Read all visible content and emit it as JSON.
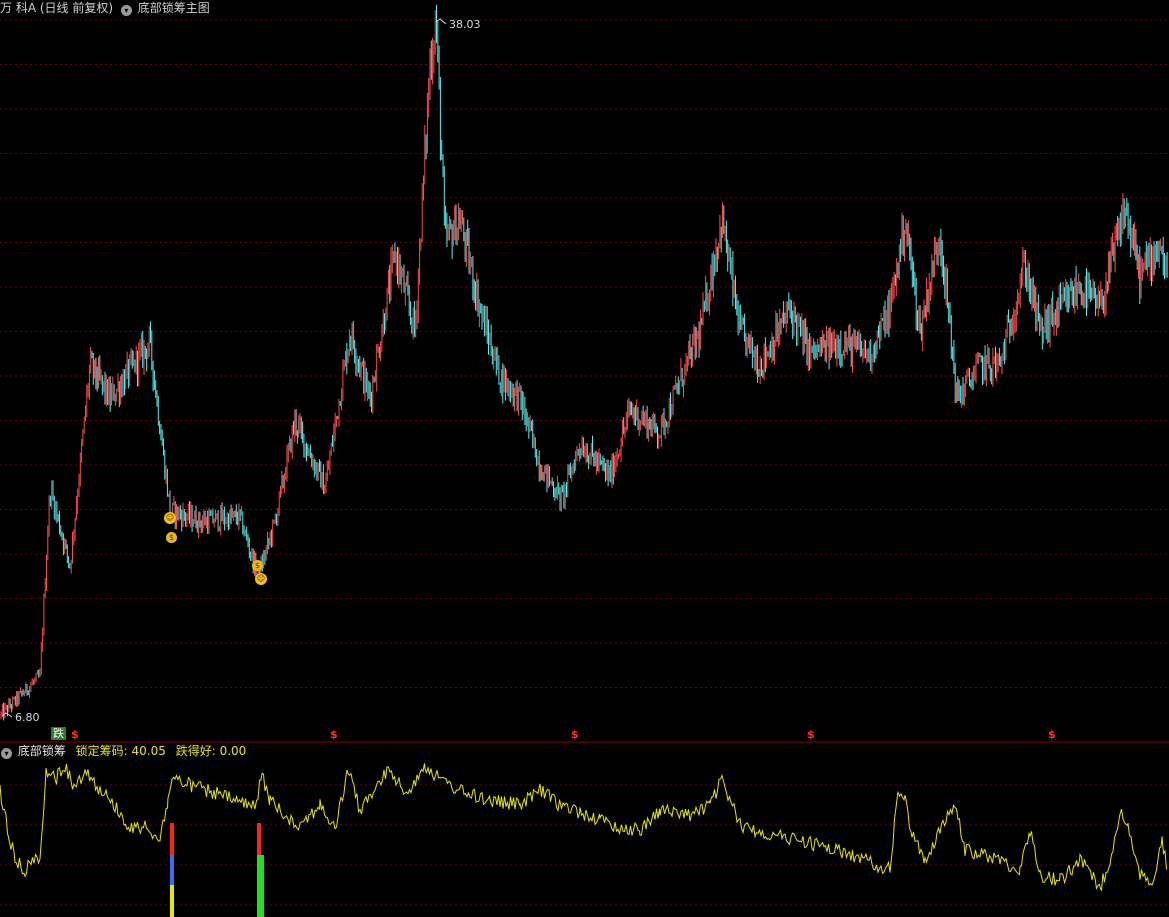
{
  "header": {
    "stock_name": "万 科A",
    "mode": "(日线 前复权)",
    "main_indicator": "底部锁筹主图"
  },
  "sub_header": {
    "indicator": "底部锁筹",
    "lock_label": "锁定筹码: 40.05",
    "good_label": "跌得好: 0.00"
  },
  "labels": {
    "high": "38.03",
    "low": "6.80",
    "die": "跌",
    "dollar": "$"
  },
  "colors": {
    "up": "#ff4c4c",
    "down": "#4cf0f0",
    "indicator_line": "#e6e600",
    "grid": "#6a0000",
    "separator": "#8b0000",
    "bar_red": "#ff2020",
    "bar_green": "#20e020"
  },
  "chart_data": [
    {
      "type": "candlestick",
      "title": "万 科A (日线 前复权)",
      "ylim": [
        6.8,
        38.03
      ],
      "labels": {
        "max": 38.03,
        "min": 6.8
      },
      "close_trend": [
        [
          0,
          6.8
        ],
        [
          40,
          8.6
        ],
        [
          50,
          17.0
        ],
        [
          70,
          13.5
        ],
        [
          90,
          22.5
        ],
        [
          110,
          21.0
        ],
        [
          150,
          23.5
        ],
        [
          170,
          16.0
        ],
        [
          200,
          15.5
        ],
        [
          240,
          15.7
        ],
        [
          258,
          13.0
        ],
        [
          275,
          15.5
        ],
        [
          295,
          20.0
        ],
        [
          325,
          17.0
        ],
        [
          350,
          24.0
        ],
        [
          370,
          21.0
        ],
        [
          395,
          27.5
        ],
        [
          415,
          24.0
        ],
        [
          430,
          36.0
        ],
        [
          436,
          38.0
        ],
        [
          445,
          28.0
        ],
        [
          460,
          29.0
        ],
        [
          480,
          25.0
        ],
        [
          500,
          22.0
        ],
        [
          520,
          21.0
        ],
        [
          540,
          18.0
        ],
        [
          562,
          16.5
        ],
        [
          580,
          19.0
        ],
        [
          610,
          17.5
        ],
        [
          630,
          20.5
        ],
        [
          660,
          19.5
        ],
        [
          700,
          24.0
        ],
        [
          722,
          29.0
        ],
        [
          740,
          24.0
        ],
        [
          760,
          22.5
        ],
        [
          790,
          25.0
        ],
        [
          810,
          23.0
        ],
        [
          840,
          23.5
        ],
        [
          870,
          23.0
        ],
        [
          890,
          25.0
        ],
        [
          905,
          29.0
        ],
        [
          920,
          24.0
        ],
        [
          940,
          28.5
        ],
        [
          957,
          21.0
        ],
        [
          980,
          22.5
        ],
        [
          1000,
          22.5
        ],
        [
          1025,
          27.0
        ],
        [
          1040,
          24.0
        ],
        [
          1080,
          26.0
        ],
        [
          1100,
          25.0
        ],
        [
          1125,
          29.5
        ],
        [
          1140,
          26.5
        ],
        [
          1160,
          28.0
        ],
        [
          1168,
          26.0
        ]
      ]
    },
    {
      "type": "line",
      "title": "底部锁筹",
      "series": [
        {
          "name": "锁定筹码",
          "last_value": 40.05
        },
        {
          "name": "跌得好",
          "last_value": 0.0
        }
      ]
    }
  ]
}
